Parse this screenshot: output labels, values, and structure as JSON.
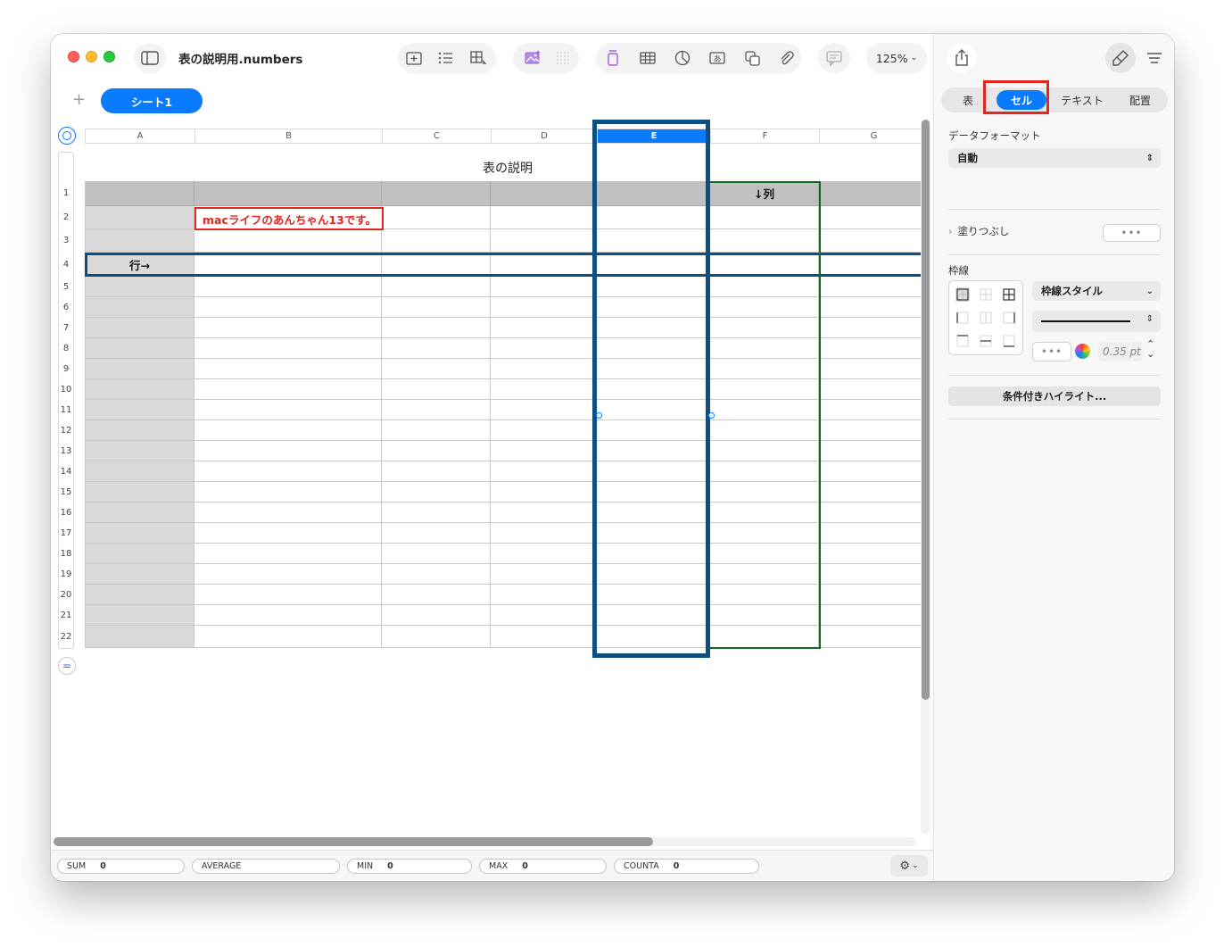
{
  "window": {
    "title": "表の説明用.numbers"
  },
  "toolbar": {
    "zoom": "125%",
    "icons": [
      "sidebar-icon",
      "insert-icon",
      "list-icon",
      "table-options-icon",
      "media-icon",
      "grid-dots-icon",
      "text-box-icon",
      "table-icon",
      "chart-icon",
      "textbox-a-icon",
      "shape-icon",
      "attachment-icon",
      "comment-icon"
    ]
  },
  "sheets": {
    "add": "+",
    "tabs": [
      "シート1"
    ]
  },
  "table": {
    "title": "表の説明",
    "columns": [
      "A",
      "B",
      "C",
      "D",
      "E",
      "F",
      "G"
    ],
    "selected_column": "E",
    "rows": [
      "1",
      "2",
      "3",
      "4",
      "5",
      "6",
      "7",
      "8",
      "9",
      "10",
      "11",
      "12",
      "13",
      "14",
      "15",
      "16",
      "17",
      "18",
      "19",
      "20",
      "21",
      "22"
    ],
    "cells": {
      "F1": "↓列",
      "A4": "行→",
      "B2": "macライフのあんちゃん13です。"
    }
  },
  "statusbar": {
    "items": [
      {
        "label": "SUM",
        "value": "0"
      },
      {
        "label": "AVERAGE",
        "value": ""
      },
      {
        "label": "MIN",
        "value": "0"
      },
      {
        "label": "MAX",
        "value": "0"
      },
      {
        "label": "COUNTA",
        "value": "0"
      }
    ]
  },
  "sidebar": {
    "tabs": [
      "表",
      "セル",
      "テキスト",
      "配置"
    ],
    "active_tab": "セル",
    "data_format_label": "データフォーマット",
    "data_format_value": "自動",
    "fill_label": "塗りつぶし",
    "border_label": "枠線",
    "border_style_value": "枠線スタイル",
    "stroke_width": "0.35 pt",
    "conditional_highlight": "条件付きハイライト..."
  },
  "colors": {
    "accent": "#0a7aff",
    "highlight_blue": "#0d4f80",
    "highlight_green": "#106a1b",
    "annotation_red": "#e3261f",
    "header_row": "#c0c0c0",
    "header_col": "#d9d9d9"
  }
}
